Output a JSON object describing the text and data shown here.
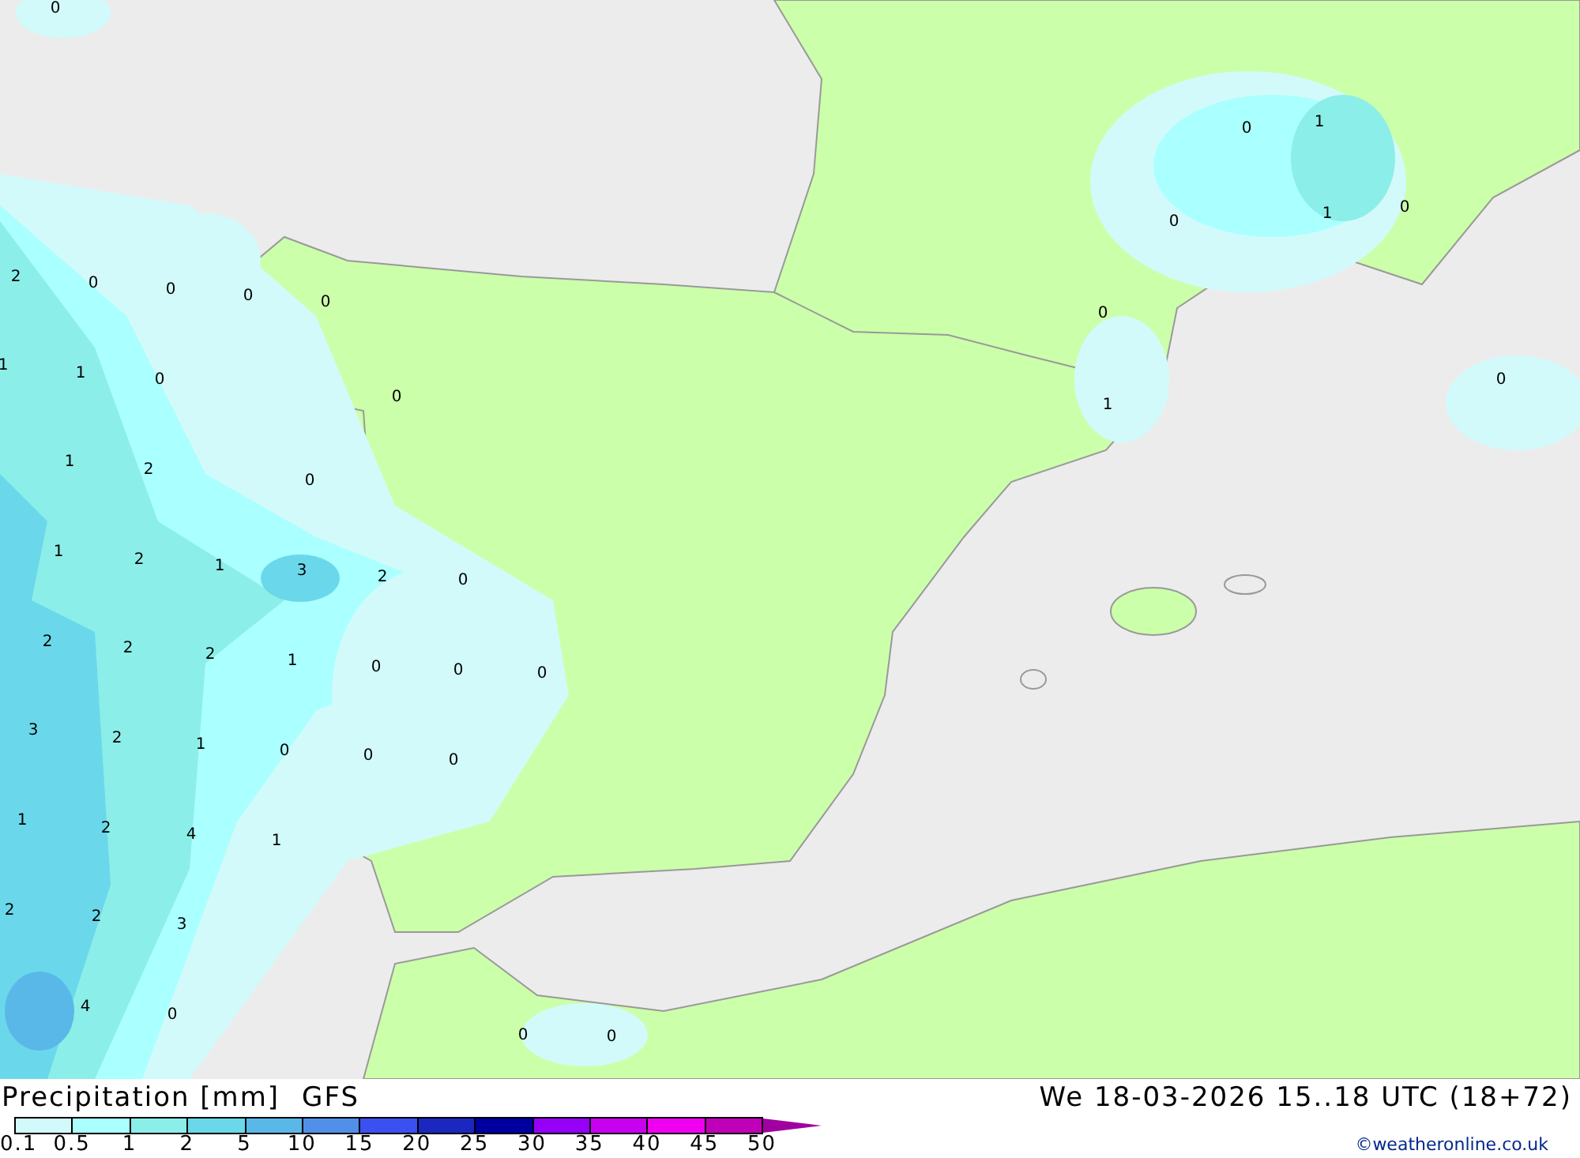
{
  "map": {
    "labels": [
      {
        "text": "0"
      },
      {
        "text": "2"
      },
      {
        "text": "0"
      },
      {
        "text": "0"
      },
      {
        "text": "0"
      },
      {
        "text": "0"
      },
      {
        "text": "1"
      },
      {
        "text": "1"
      },
      {
        "text": "0"
      },
      {
        "text": "0"
      },
      {
        "text": "1"
      },
      {
        "text": "2"
      },
      {
        "text": "0"
      },
      {
        "text": "1"
      },
      {
        "text": "2"
      },
      {
        "text": "1"
      },
      {
        "text": "3"
      },
      {
        "text": "2"
      },
      {
        "text": "0"
      },
      {
        "text": "2"
      },
      {
        "text": "2"
      },
      {
        "text": "2"
      },
      {
        "text": "1"
      },
      {
        "text": "0"
      },
      {
        "text": "0"
      },
      {
        "text": "0"
      },
      {
        "text": "3"
      },
      {
        "text": "2"
      },
      {
        "text": "1"
      },
      {
        "text": "0"
      },
      {
        "text": "0"
      },
      {
        "text": "0"
      },
      {
        "text": "1"
      },
      {
        "text": "2"
      },
      {
        "text": "4"
      },
      {
        "text": "1"
      },
      {
        "text": "2"
      },
      {
        "text": "2"
      },
      {
        "text": "3"
      },
      {
        "text": "4"
      },
      {
        "text": "0"
      },
      {
        "text": "0"
      },
      {
        "text": "0"
      },
      {
        "text": "0"
      },
      {
        "text": "1"
      },
      {
        "text": "0"
      },
      {
        "text": "1"
      },
      {
        "text": "0"
      },
      {
        "text": "0"
      },
      {
        "text": "1"
      },
      {
        "text": "0"
      }
    ]
  },
  "footer": {
    "title": "Precipitation [mm]",
    "model": "GFS",
    "valid_time": "We 18-03-2026 15..18 UTC (18+72)",
    "credit": "©weatheronline.co.uk"
  },
  "legend": {
    "segments": [
      {
        "color": "#d2fafa"
      },
      {
        "color": "#aaffff"
      },
      {
        "color": "#8ceee8"
      },
      {
        "color": "#6ad8ea"
      },
      {
        "color": "#5ab8e8"
      },
      {
        "color": "#5090e8"
      },
      {
        "color": "#3a50f0"
      },
      {
        "color": "#1a28c0"
      },
      {
        "color": "#0000a0"
      },
      {
        "color": "#9600f8"
      },
      {
        "color": "#c800f0"
      },
      {
        "color": "#f000f0"
      },
      {
        "color": "#c000b8"
      }
    ],
    "arrow": {
      "color": "#a000a0"
    },
    "ticks": [
      "0.1",
      "0.5",
      "1",
      "2",
      "5",
      "10",
      "15",
      "20",
      "25",
      "30",
      "35",
      "40",
      "45",
      "50"
    ]
  }
}
